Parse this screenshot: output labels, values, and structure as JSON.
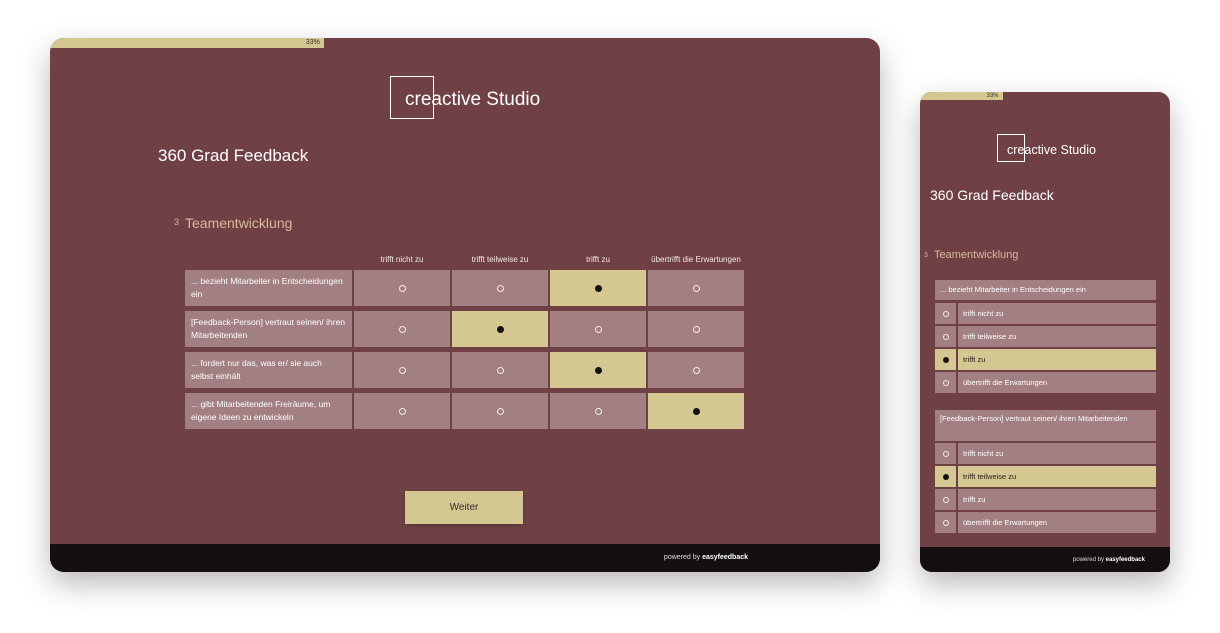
{
  "progress": {
    "label": "33%",
    "fraction": 0.33
  },
  "logo": {
    "text": "creactive Studio"
  },
  "survey_title": "360 Grad Feedback",
  "section": {
    "number": "3",
    "title": "Teamentwicklung"
  },
  "columns": [
    "trifft nicht zu",
    "trifft teilweise zu",
    "trifft zu",
    "übertrifft die Erwartungen"
  ],
  "rows": [
    {
      "label": "... bezieht Mitarbeiter in Entscheidungen ein",
      "selected": 2
    },
    {
      "label": "[Feedback-Person] vertraut seinen/ ihren Mitarbeitenden",
      "selected": 1
    },
    {
      "label": "... fordert nur das, was er/ sie auch selbst einhält",
      "selected": 2
    },
    {
      "label": "... gibt Mitarbeitenden Freiräume, um eigene Ideen zu entwickeln",
      "selected": 3
    }
  ],
  "next_button": "Weiter",
  "footer": {
    "prefix": "powered by",
    "brand": "easyfeedback"
  },
  "colors": {
    "background": "#6f4145",
    "accent": "#d4c791",
    "cell": "#a27f82",
    "footer": "#151010",
    "section": "#d8b99a"
  }
}
